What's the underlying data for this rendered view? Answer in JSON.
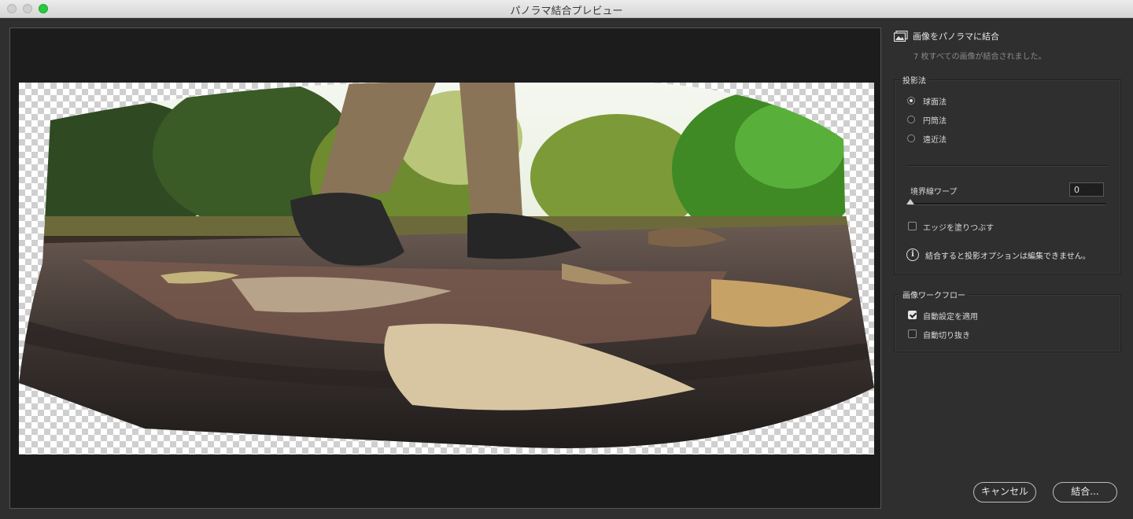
{
  "window": {
    "title": "パノラマ結合プレビュー"
  },
  "panel": {
    "header_title": "画像をパノラマに結合",
    "header_icon": "photos-stack-icon",
    "subtitle": "7 枚すべての画像が結合されました。",
    "projection": {
      "label": "投影法",
      "options": [
        {
          "label": "球面法",
          "selected": true
        },
        {
          "label": "円筒法",
          "selected": false
        },
        {
          "label": "遠近法",
          "selected": false
        }
      ],
      "boundary_warp_label": "境界線ワープ",
      "boundary_warp_value": "0",
      "fill_edges_label": "エッジを塗りつぶす",
      "fill_edges_checked": false,
      "info_text": "結合すると投影オプションは編集できません。"
    },
    "workflow": {
      "label": "画像ワークフロー",
      "auto_settings_label": "自動設定を適用",
      "auto_settings_checked": true,
      "auto_crop_label": "自動切り抜き",
      "auto_crop_checked": false
    }
  },
  "buttons": {
    "cancel": "キャンセル",
    "merge": "結合..."
  }
}
